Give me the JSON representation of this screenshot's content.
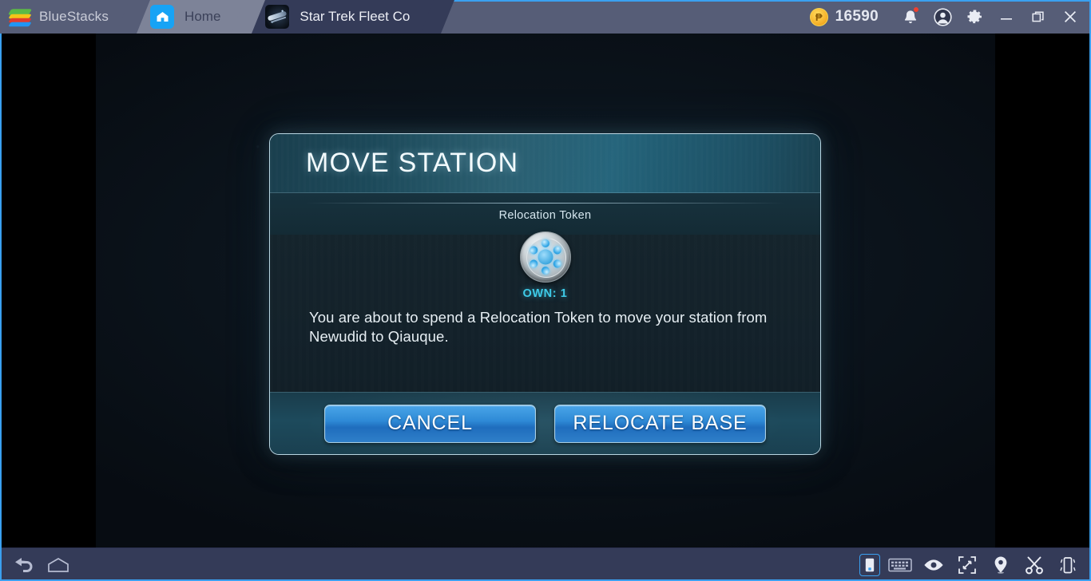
{
  "titlebar": {
    "brand": "BlueStacks",
    "brand_icon": "bluestacks-logo",
    "tabs": [
      {
        "label": "Home",
        "icon": "home-icon",
        "active": false
      },
      {
        "label": "Star Trek Fleet Co",
        "icon": "game-thumbnail-icon",
        "active": true
      }
    ],
    "points": {
      "icon": "bluestacks-points-coin-icon",
      "glyph": "₱",
      "amount": "16590"
    },
    "icons": [
      {
        "name": "notifications-bell-icon",
        "has_badge": true
      },
      {
        "name": "account-avatar-icon"
      },
      {
        "name": "settings-gear-icon"
      },
      {
        "name": "minimize-icon"
      },
      {
        "name": "restore-window-icon"
      },
      {
        "name": "close-window-icon"
      }
    ]
  },
  "dialog": {
    "title": "MOVE STATION",
    "token_label": "Relocation Token",
    "token_icon": "relocation-token-icon",
    "own_label": "OWN: 1",
    "body_text": "You are about to spend a Relocation Token to move your station from Newudid to Qiauque.",
    "buttons": {
      "cancel": "CANCEL",
      "confirm": "RELOCATE BASE"
    },
    "accent_color": "#3ecbe8",
    "button_color": "#2e8ad6",
    "border_color": "#b9d6e2"
  },
  "bottombar": {
    "left_icons": [
      {
        "name": "back-arrow-icon"
      },
      {
        "name": "home-pentagon-icon"
      }
    ],
    "right_icons": [
      {
        "name": "portrait-mode-icon",
        "active": true
      },
      {
        "name": "on-screen-keyboard-icon"
      },
      {
        "name": "eye-macro-icon"
      },
      {
        "name": "fullscreen-icon"
      },
      {
        "name": "location-pin-icon"
      },
      {
        "name": "scissors-screenshot-icon"
      },
      {
        "name": "shake-device-icon"
      }
    ]
  }
}
